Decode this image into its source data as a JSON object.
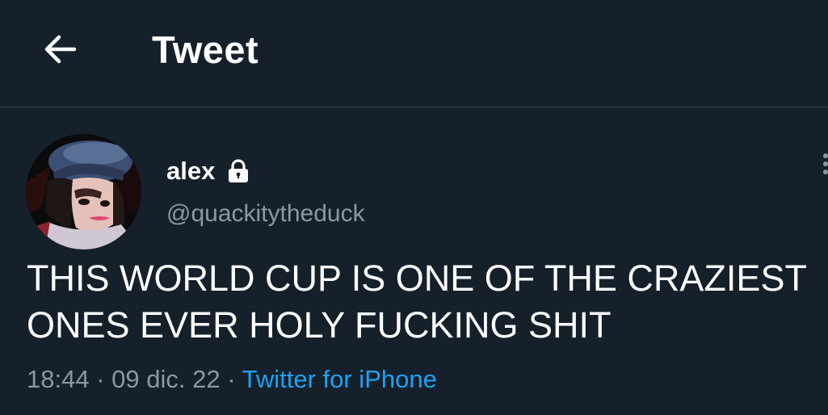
{
  "header": {
    "back_icon": "arrow-left-icon",
    "title": "Tweet"
  },
  "tweet": {
    "author": {
      "display_name": "alex",
      "handle": "@quackitytheduck",
      "protected_icon": "lock-icon",
      "avatar_icon": "profile-photo"
    },
    "text": "THIS WORLD CUP IS ONE OF THE CRAZIEST ONES EVER HOLY FUCKING SHIT",
    "time": "18:44",
    "separator": "·",
    "date": "09 dic. 22",
    "source": "Twitter for iPhone",
    "more_icon": "more-options-icon"
  },
  "colors": {
    "background": "#15202b",
    "text": "#ffffff",
    "secondary_text": "#8899a6",
    "link": "#1da1f2",
    "divider": "#38444d"
  }
}
